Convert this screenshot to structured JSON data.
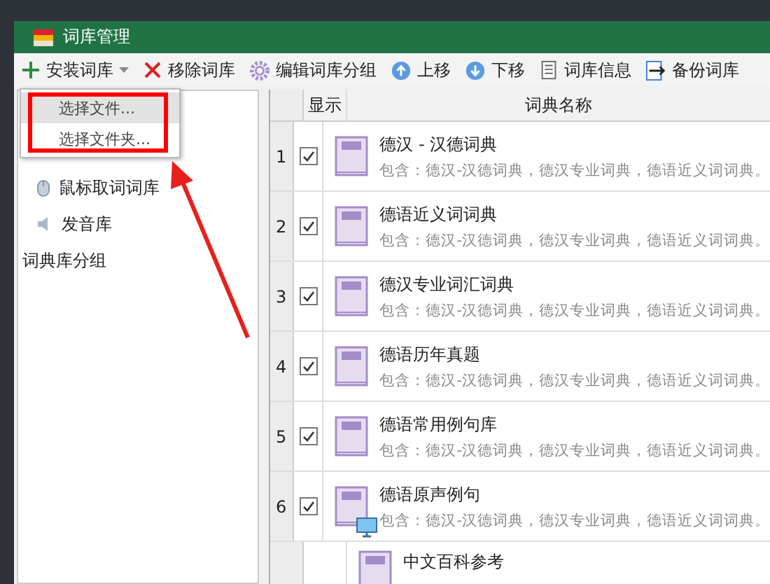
{
  "window": {
    "title": "词库管理"
  },
  "toolbar": [
    {
      "kind": "plus",
      "label": "安装词库",
      "dropdown": true
    },
    {
      "kind": "cross",
      "label": "移除词库",
      "dropdown": false
    },
    {
      "kind": "gear",
      "label": "编辑词库分组",
      "dropdown": false
    },
    {
      "kind": "up",
      "label": "上移",
      "dropdown": false
    },
    {
      "kind": "down",
      "label": "下移",
      "dropdown": false
    },
    {
      "kind": "doc",
      "label": "词库信息",
      "dropdown": false
    },
    {
      "kind": "export",
      "label": "备份词库",
      "dropdown": false
    }
  ],
  "install_menu": [
    {
      "label": "选择文件...",
      "selected": true
    },
    {
      "label": "选择文件夹...",
      "selected": false
    }
  ],
  "sidebar": {
    "items": [
      {
        "kind": "mouse",
        "label": "鼠标取词词库"
      },
      {
        "kind": "speaker",
        "label": "发音库"
      }
    ],
    "group_label": "词典库分组"
  },
  "table": {
    "columns": [
      {
        "label": "显示"
      },
      {
        "label": "词典名称"
      }
    ],
    "rows": [
      {
        "number": "1",
        "checked": true,
        "title": "德汉 - 汉德词典",
        "description": "包含：德汉-汉德词典，德汉专业词典，德语近义词词典。"
      },
      {
        "number": "2",
        "checked": true,
        "title": "德语近义词词典",
        "description": "包含：德汉-汉德词典，德汉专业词典，德语近义词词典。"
      },
      {
        "number": "3",
        "checked": true,
        "title": "德汉专业词汇词典",
        "description": "包含：德汉-汉德词典，德汉专业词典，德语近义词词典。"
      },
      {
        "number": "4",
        "checked": true,
        "title": "德语历年真题",
        "description": "包含：德汉-汉德词典，德汉专业词典，德语近义词词典。"
      },
      {
        "number": "5",
        "checked": true,
        "title": "德语常用例句库",
        "description": "包含：德汉-汉德词典，德汉专业词典，德语近义词词典。"
      },
      {
        "number": "6",
        "checked": true,
        "title": "德语原声例句",
        "description": "包含：德汉-汉德词典，德汉专业词典，德语近义词词典。"
      },
      {
        "title": "中文百科参考"
      }
    ]
  }
}
